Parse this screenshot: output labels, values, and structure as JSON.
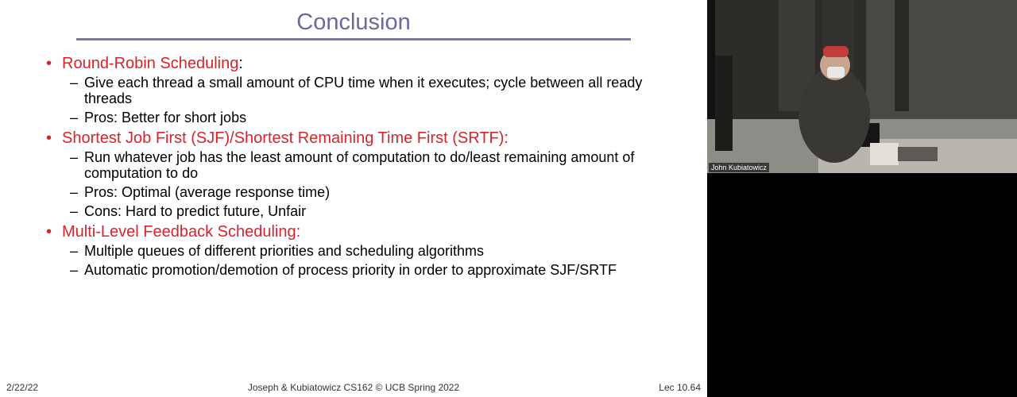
{
  "slide": {
    "title": "Conclusion",
    "bullets": [
      {
        "heading": "Round-Robin Scheduling",
        "suffix": ":",
        "subs": [
          "Give each thread a small amount of CPU time when it executes; cycle between all ready threads",
          "Pros: Better for short jobs"
        ]
      },
      {
        "heading": "Shortest Job First (SJF)/Shortest Remaining Time First (SRTF):",
        "suffix": "",
        "subs": [
          "Run whatever job has the least amount of computation to do/least remaining amount of computation to do",
          "Pros: Optimal (average response time)",
          "Cons: Hard to predict future, Unfair"
        ]
      },
      {
        "heading": "Multi-Level Feedback Scheduling:",
        "suffix": "",
        "subs": [
          "Multiple queues of different priorities and scheduling algorithms",
          "Automatic promotion/demotion of process priority in order to approximate SJF/SRTF"
        ]
      }
    ],
    "footer": {
      "date": "2/22/22",
      "center": "Joseph & Kubiatowicz CS162 © UCB Spring 2022",
      "lecture": "Lec 10.64"
    }
  },
  "video": {
    "speaker_name": "John Kubiatowicz"
  },
  "colors": {
    "title": "#6a6a9a",
    "bullet_heading": "#d8232a",
    "rule": "#7c7c96",
    "background": "#000000"
  }
}
